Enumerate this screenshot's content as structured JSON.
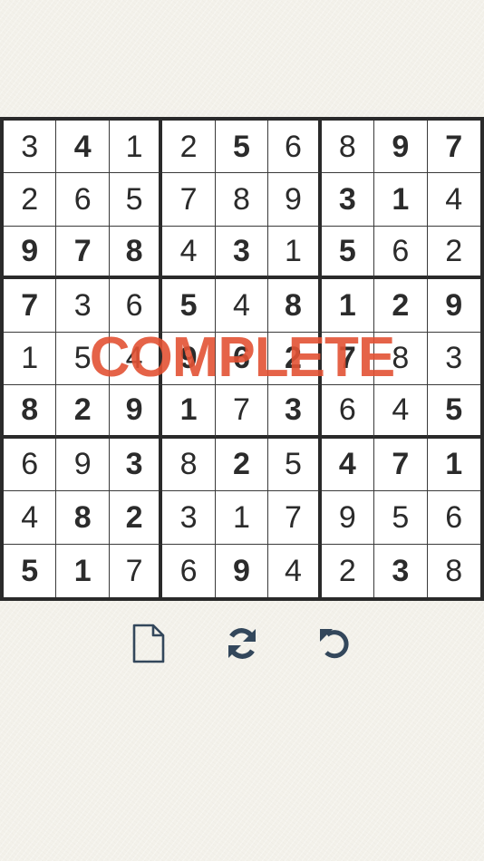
{
  "game": {
    "status_text": "COMPLETE",
    "status_color": "#e25234",
    "grid_line_color": "#2a2a2a",
    "digit_color": "#2b2b2b"
  },
  "board": {
    "rows": [
      [
        {
          "v": "3",
          "g": false
        },
        {
          "v": "4",
          "g": true
        },
        {
          "v": "1",
          "g": false
        },
        {
          "v": "2",
          "g": false
        },
        {
          "v": "5",
          "g": true
        },
        {
          "v": "6",
          "g": false
        },
        {
          "v": "8",
          "g": false
        },
        {
          "v": "9",
          "g": true
        },
        {
          "v": "7",
          "g": true
        }
      ],
      [
        {
          "v": "2",
          "g": false
        },
        {
          "v": "6",
          "g": false
        },
        {
          "v": "5",
          "g": false
        },
        {
          "v": "7",
          "g": false
        },
        {
          "v": "8",
          "g": false
        },
        {
          "v": "9",
          "g": false
        },
        {
          "v": "3",
          "g": true
        },
        {
          "v": "1",
          "g": true
        },
        {
          "v": "4",
          "g": false
        }
      ],
      [
        {
          "v": "9",
          "g": true
        },
        {
          "v": "7",
          "g": true
        },
        {
          "v": "8",
          "g": true
        },
        {
          "v": "4",
          "g": false
        },
        {
          "v": "3",
          "g": true
        },
        {
          "v": "1",
          "g": false
        },
        {
          "v": "5",
          "g": true
        },
        {
          "v": "6",
          "g": false
        },
        {
          "v": "2",
          "g": false
        }
      ],
      [
        {
          "v": "7",
          "g": true
        },
        {
          "v": "3",
          "g": false
        },
        {
          "v": "6",
          "g": false
        },
        {
          "v": "5",
          "g": true
        },
        {
          "v": "4",
          "g": false
        },
        {
          "v": "8",
          "g": true
        },
        {
          "v": "1",
          "g": true
        },
        {
          "v": "2",
          "g": true
        },
        {
          "v": "9",
          "g": true
        }
      ],
      [
        {
          "v": "1",
          "g": false
        },
        {
          "v": "5",
          "g": false
        },
        {
          "v": "4",
          "g": false
        },
        {
          "v": "9",
          "g": true
        },
        {
          "v": "6",
          "g": true
        },
        {
          "v": "2",
          "g": true
        },
        {
          "v": "7",
          "g": true
        },
        {
          "v": "8",
          "g": false
        },
        {
          "v": "3",
          "g": false
        }
      ],
      [
        {
          "v": "8",
          "g": true
        },
        {
          "v": "2",
          "g": true
        },
        {
          "v": "9",
          "g": true
        },
        {
          "v": "1",
          "g": true
        },
        {
          "v": "7",
          "g": false
        },
        {
          "v": "3",
          "g": true
        },
        {
          "v": "6",
          "g": false
        },
        {
          "v": "4",
          "g": false
        },
        {
          "v": "5",
          "g": true
        }
      ],
      [
        {
          "v": "6",
          "g": false
        },
        {
          "v": "9",
          "g": false
        },
        {
          "v": "3",
          "g": true
        },
        {
          "v": "8",
          "g": false
        },
        {
          "v": "2",
          "g": true
        },
        {
          "v": "5",
          "g": false
        },
        {
          "v": "4",
          "g": true
        },
        {
          "v": "7",
          "g": true
        },
        {
          "v": "1",
          "g": true
        }
      ],
      [
        {
          "v": "4",
          "g": false
        },
        {
          "v": "8",
          "g": true
        },
        {
          "v": "2",
          "g": true
        },
        {
          "v": "3",
          "g": false
        },
        {
          "v": "1",
          "g": false
        },
        {
          "v": "7",
          "g": false
        },
        {
          "v": "9",
          "g": false
        },
        {
          "v": "5",
          "g": false
        },
        {
          "v": "6",
          "g": false
        }
      ],
      [
        {
          "v": "5",
          "g": true
        },
        {
          "v": "1",
          "g": true
        },
        {
          "v": "7",
          "g": false
        },
        {
          "v": "6",
          "g": false
        },
        {
          "v": "9",
          "g": true
        },
        {
          "v": "4",
          "g": false
        },
        {
          "v": "2",
          "g": false
        },
        {
          "v": "3",
          "g": true
        },
        {
          "v": "8",
          "g": false
        }
      ]
    ]
  },
  "toolbar": {
    "icon_color": "#33475b",
    "buttons": [
      {
        "icon": "new-document-icon"
      },
      {
        "icon": "refresh-icon"
      },
      {
        "icon": "undo-icon"
      }
    ]
  }
}
